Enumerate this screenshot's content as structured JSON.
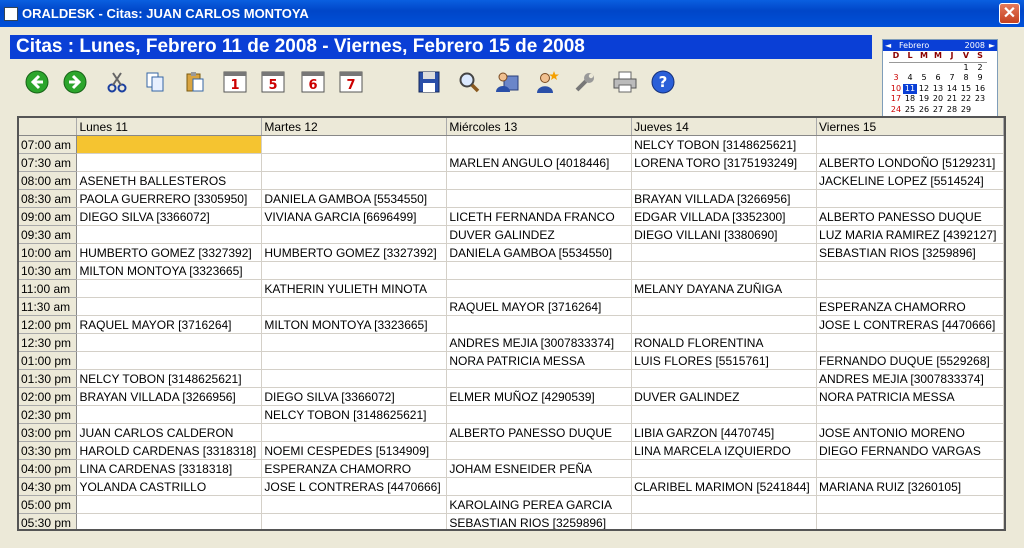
{
  "window": {
    "title": "ORALDESK - Citas: JUAN CARLOS MONTOYA",
    "close_label": "✕"
  },
  "header": {
    "title": "Citas : Lunes, Febrero 11 de 2008 - Viernes, Febrero 15 de 2008"
  },
  "toolbar": [
    {
      "name": "back-button",
      "icon": "arrow-left-icon"
    },
    {
      "name": "forward-button",
      "icon": "arrow-right-icon"
    },
    {
      "name": "cut-button",
      "icon": "scissors-icon"
    },
    {
      "name": "copy-button",
      "icon": "copy-icon"
    },
    {
      "name": "paste-button",
      "icon": "paste-icon"
    },
    {
      "name": "day-view-button",
      "icon": "calendar-day-icon",
      "label": "1"
    },
    {
      "name": "workweek-view-button",
      "icon": "calendar-workweek-icon",
      "label": "5"
    },
    {
      "name": "six-day-view-button",
      "icon": "calendar-six-icon",
      "label": "6"
    },
    {
      "name": "week-view-button",
      "icon": "calendar-week-icon",
      "label": "7"
    },
    {
      "name": "save-button",
      "icon": "floppy-disk-icon"
    },
    {
      "name": "search-button",
      "icon": "magnifier-icon"
    },
    {
      "name": "patient-card-button",
      "icon": "person-card-icon"
    },
    {
      "name": "new-patient-button",
      "icon": "person-star-icon"
    },
    {
      "name": "settings-button",
      "icon": "wrench-icon"
    },
    {
      "name": "print-button",
      "icon": "printer-icon"
    },
    {
      "name": "help-button",
      "icon": "help-icon"
    }
  ],
  "mini_calendar": {
    "month": "Febrero",
    "year": "2008",
    "prev": "◄",
    "next": "►",
    "days_of_week": [
      "D",
      "L",
      "M",
      "M",
      "J",
      "V",
      "S"
    ],
    "weeks": [
      [
        "",
        "",
        "",
        "",
        "",
        "1",
        "2"
      ],
      [
        "3",
        "4",
        "5",
        "6",
        "7",
        "8",
        "9"
      ],
      [
        "10",
        "11",
        "12",
        "13",
        "14",
        "15",
        "16"
      ],
      [
        "17",
        "18",
        "19",
        "20",
        "21",
        "22",
        "23"
      ],
      [
        "24",
        "25",
        "26",
        "27",
        "28",
        "29",
        ""
      ]
    ],
    "today": "11"
  },
  "schedule": {
    "columns": [
      "Lunes 11",
      "Martes 12",
      "Miércoles 13",
      "Jueves 14",
      "Viernes 15"
    ],
    "rows": [
      {
        "time": "07:00 am",
        "cells": [
          "",
          "",
          "",
          "NELCY TOBON  [3148625621]",
          ""
        ]
      },
      {
        "time": "07:30 am",
        "cells": [
          "",
          "",
          "MARLEN ANGULO  [4018446]",
          "LORENA TORO  [3175193249]",
          "ALBERTO LONDOÑO  [5129231]"
        ]
      },
      {
        "time": "08:00 am",
        "cells": [
          "ASENETH BALLESTEROS",
          "",
          "",
          "",
          "JACKELINE LOPEZ  [5514524]"
        ]
      },
      {
        "time": "08:30 am",
        "cells": [
          "PAOLA GUERRERO  [3305950]",
          "DANIELA GAMBOA  [5534550]",
          "",
          "BRAYAN VILLADA  [3266956]",
          ""
        ]
      },
      {
        "time": "09:00 am",
        "cells": [
          "DIEGO SILVA  [3366072]",
          "VIVIANA GARCIA  [6696499]",
          "LICETH FERNANDA FRANCO",
          "EDGAR VILLADA  [3352300]",
          "ALBERTO PANESSO DUQUE"
        ]
      },
      {
        "time": "09:30 am",
        "cells": [
          "",
          "",
          "DUVER GALINDEZ",
          "DIEGO VILLANI  [3380690]",
          "LUZ MARIA RAMIREZ  [4392127]"
        ]
      },
      {
        "time": "10:00 am",
        "cells": [
          "HUMBERTO GOMEZ  [3327392]",
          "HUMBERTO GOMEZ  [3327392]",
          "DANIELA GAMBOA  [5534550]",
          "",
          "SEBASTIAN RIOS  [3259896]"
        ]
      },
      {
        "time": "10:30 am",
        "cells": [
          "MILTON MONTOYA  [3323665]",
          "",
          "",
          "",
          ""
        ]
      },
      {
        "time": "11:00 am",
        "cells": [
          "",
          "KATHERIN YULIETH MINOTA",
          "",
          "MELANY DAYANA ZUÑIGA",
          ""
        ]
      },
      {
        "time": "11:30 am",
        "cells": [
          "",
          "",
          "RAQUEL MAYOR  [3716264]",
          "",
          "ESPERANZA CHAMORRO"
        ]
      },
      {
        "time": "12:00 pm",
        "cells": [
          "RAQUEL MAYOR  [3716264]",
          "MILTON MONTOYA  [3323665]",
          "",
          "",
          "JOSE L CONTRERAS  [4470666]"
        ]
      },
      {
        "time": "12:30 pm",
        "cells": [
          "",
          "",
          "ANDRES MEJIA  [3007833374]",
          "RONALD FLORENTINA",
          ""
        ]
      },
      {
        "time": "01:00 pm",
        "cells": [
          "",
          "",
          "NORA PATRICIA MESSA",
          "LUIS FLORES  [5515761]",
          "FERNANDO DUQUE  [5529268]"
        ]
      },
      {
        "time": "01:30 pm",
        "cells": [
          "NELCY TOBON  [3148625621]",
          "",
          "",
          "",
          "ANDRES MEJIA  [3007833374]"
        ]
      },
      {
        "time": "02:00 pm",
        "cells": [
          "BRAYAN VILLADA  [3266956]",
          "DIEGO SILVA  [3366072]",
          "ELMER MUÑOZ  [4290539]",
          "DUVER GALINDEZ",
          "NORA PATRICIA MESSA"
        ]
      },
      {
        "time": "02:30 pm",
        "cells": [
          "",
          "NELCY TOBON  [3148625621]",
          "",
          "",
          ""
        ]
      },
      {
        "time": "03:00 pm",
        "cells": [
          "JUAN CARLOS CALDERON",
          "",
          "ALBERTO PANESSO DUQUE",
          "LIBIA GARZON  [4470745]",
          "JOSE ANTONIO MORENO"
        ]
      },
      {
        "time": "03:30 pm",
        "cells": [
          "HAROLD CARDENAS  [3318318]",
          "NOEMI CESPEDES  [5134909]",
          "",
          "LINA MARCELA IZQUIERDO",
          "DIEGO FERNANDO VARGAS"
        ]
      },
      {
        "time": "04:00 pm",
        "cells": [
          "LINA CARDENAS  [3318318]",
          "ESPERANZA CHAMORRO",
          "JOHAM ESNEIDER PEÑA",
          "",
          ""
        ]
      },
      {
        "time": "04:30 pm",
        "cells": [
          "YOLANDA CASTRILLO",
          "JOSE L CONTRERAS  [4470666]",
          "",
          "CLARIBEL MARIMON  [5241844]",
          "MARIANA RUIZ  [3260105]"
        ]
      },
      {
        "time": "05:00 pm",
        "cells": [
          "",
          "",
          "KAROLAING PEREA GARCIA",
          "",
          ""
        ]
      },
      {
        "time": "05:30 pm",
        "cells": [
          "",
          "",
          "SEBASTIAN RIOS  [3259896]",
          "",
          ""
        ]
      }
    ],
    "selected": {
      "row": 0,
      "col": 0
    }
  },
  "colors": {
    "header_bg": "#0a3fd6",
    "selection": "#f5c430",
    "today": "#0a3fd6"
  }
}
